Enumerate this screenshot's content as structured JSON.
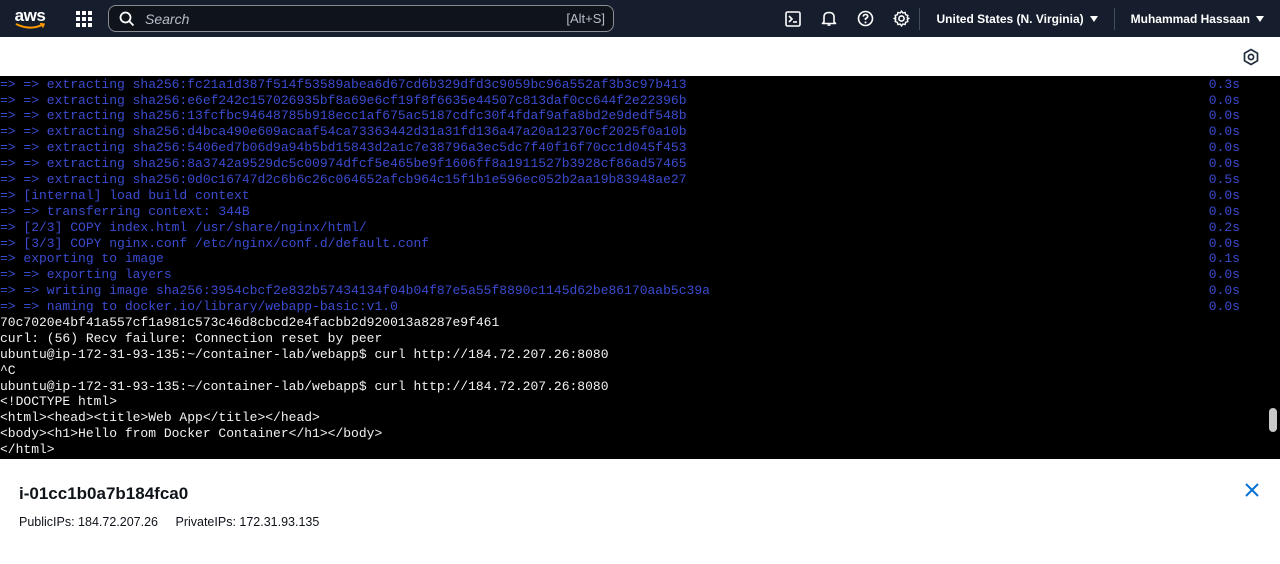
{
  "nav": {
    "logo_text": "aws",
    "search_placeholder": "Search",
    "search_shortcut": "[Alt+S]",
    "region": "United States (N. Virginia)",
    "user": "Muhammad Hassaan",
    "icons": [
      "cloudshell-icon",
      "bell-icon",
      "help-icon",
      "gear-icon"
    ]
  },
  "terminal": {
    "build_lines": [
      {
        "text": "=> => extracting sha256:fc21a1d387f514f53589abea6d67cd6b329dfd3c9059bc96a552af3b3c97b413",
        "time": "0.3s"
      },
      {
        "text": "=> => extracting sha256:e6ef242c157026935bf8a69e6cf19f8f6635e44507c813daf0cc644f2e22396b",
        "time": "0.0s"
      },
      {
        "text": "=> => extracting sha256:13fcfbc94648785b918ecc1af675ac5187cdfc30f4fdaf9afa8bd2e9dedf548b",
        "time": "0.0s"
      },
      {
        "text": "=> => extracting sha256:d4bca490e609acaaf54ca73363442d31a31fd136a47a20a12370cf2025f0a10b",
        "time": "0.0s"
      },
      {
        "text": "=> => extracting sha256:5406ed7b06d9a94b5bd15843d2a1c7e38796a3ec5dc7f40f16f70cc1d045f453",
        "time": "0.0s"
      },
      {
        "text": "=> => extracting sha256:8a3742a9529dc5c00974dfcf5e465be9f1606ff8a1911527b3928cf86ad57465",
        "time": "0.0s"
      },
      {
        "text": "=> => extracting sha256:0d0c16747d2c6b6c26c064652afcb964c15f1b1e596ec052b2aa19b83948ae27",
        "time": "0.5s"
      },
      {
        "text": "=> [internal] load build context",
        "time": "0.0s"
      },
      {
        "text": "=> => transferring context: 344B",
        "time": "0.0s"
      },
      {
        "text": "=> [2/3] COPY index.html /usr/share/nginx/html/",
        "time": "0.2s"
      },
      {
        "text": "=> [3/3] COPY nginx.conf /etc/nginx/conf.d/default.conf",
        "time": "0.0s"
      },
      {
        "text": "=> exporting to image",
        "time": "0.1s"
      },
      {
        "text": "=> => exporting layers",
        "time": "0.0s"
      },
      {
        "text": "=> => writing image sha256:3954cbcf2e832b57434134f04b04f87e5a55f8890c1145d62be86170aab5c39a",
        "time": "0.0s"
      },
      {
        "text": "=> => naming to docker.io/library/webapp-basic:v1.0",
        "time": "0.0s"
      }
    ],
    "output_lines": [
      "70c7020e4bf41a557cf1a981c573c46d8cbcd2e4facbb2d920013a8287e9f461",
      "curl: (56) Recv failure: Connection reset by peer",
      "ubuntu@ip-172-31-93-135:~/container-lab/webapp$ curl http://184.72.207.26:8080",
      "^C",
      "ubuntu@ip-172-31-93-135:~/container-lab/webapp$ curl http://184.72.207.26:8080",
      "<!DOCTYPE html>",
      "<html><head><title>Web App</title></head>",
      "<body><h1>Hello from Docker Container</h1></body>",
      "</html>"
    ]
  },
  "instance": {
    "id": "i-01cc1b0a7b184fca0",
    "public_ips": "PublicIPs: 184.72.207.26",
    "private_ips": "PrivateIPs: 172.31.93.135"
  }
}
